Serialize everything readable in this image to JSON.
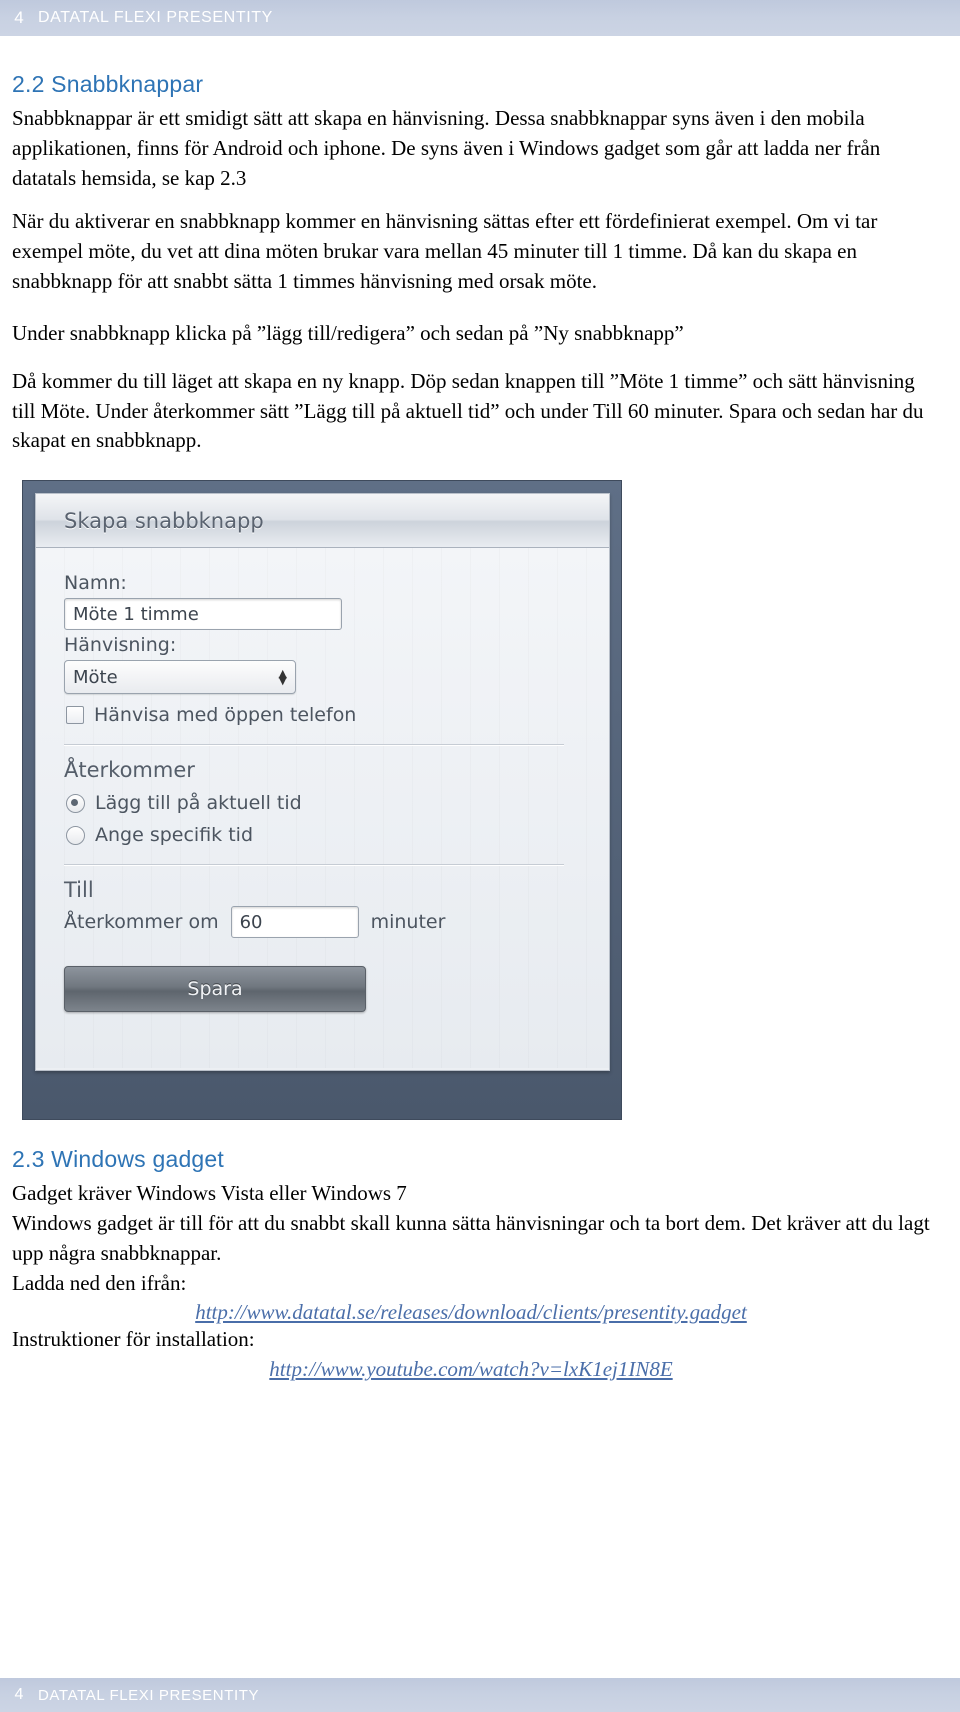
{
  "header": {
    "page_number": "4",
    "title": "DATATAL FLEXI PRESENTITY"
  },
  "footer": {
    "page_number": "4",
    "title": "DATATAL FLEXI PRESENTITY"
  },
  "sections": {
    "s22_heading": "2.2 Snabbknappar",
    "s22_p1": "Snabbknappar är ett smidigt sätt att skapa en hänvisning. Dessa snabbknappar syns även i den mobila applikationen, finns för Android och iphone. De syns även i Windows gadget som går att ladda ner från datatals hemsida, se kap 2.3",
    "s22_p2": "När du aktiverar en snabbknapp kommer en hänvisning sättas efter ett fördefinierat exempel. Om vi tar exempel möte, du vet att dina möten brukar vara mellan 45 minuter till 1 timme. Då kan du skapa en snabbknapp för att snabbt sätta 1 timmes hänvisning med orsak möte.",
    "s22_p3": "Under snabbknapp klicka på ”lägg till/redigera” och sedan på ”Ny snabbknapp”",
    "s22_p4": "Då kommer du till läget att skapa en ny knapp. Döp sedan knappen till ”Möte 1 timme” och sätt hänvisning till Möte. Under återkommer sätt ”Lägg till på aktuell tid” och under Till 60 minuter. Spara och sedan har du skapat en snabbknapp.",
    "s23_heading": "2.3 Windows gadget",
    "s23_p1": "Gadget kräver Windows Vista eller Windows 7",
    "s23_p2": "Windows gadget är till för att du snabbt skall kunna sätta hänvisningar och ta bort dem. Det kräver att du lagt upp några snabbknappar.",
    "s23_p3": "Ladda ned den ifrån:",
    "s23_link1": "http://www.datatal.se/releases/download/clients/presentity.gadget",
    "s23_p4": "Instruktioner för installation:",
    "s23_link2": "http://www.youtube.com/watch?v=lxK1ej1IN8E"
  },
  "figure": {
    "dialog_title": "Skapa snabbknapp",
    "name_label": "Namn:",
    "name_value": "Möte 1 timme",
    "referral_label": "Hänvisning:",
    "referral_value": "Möte",
    "open_phone_checkbox_label": "Hänvisa med öppen telefon",
    "recurring_label": "Återkommer",
    "radio_current_time": "Lägg till på aktuell tid",
    "radio_specific_time": "Ange specifik tid",
    "until_label": "Till",
    "recurring_in_label": "Återkommer om",
    "minutes_value": "60",
    "minutes_unit": "minuter",
    "save_label": "Spara"
  },
  "colors": {
    "header_band": "#c8d1e2",
    "heading_blue": "#2e74b5",
    "link_blue": "#4a6ea9",
    "figure_bg": "#53617a"
  }
}
